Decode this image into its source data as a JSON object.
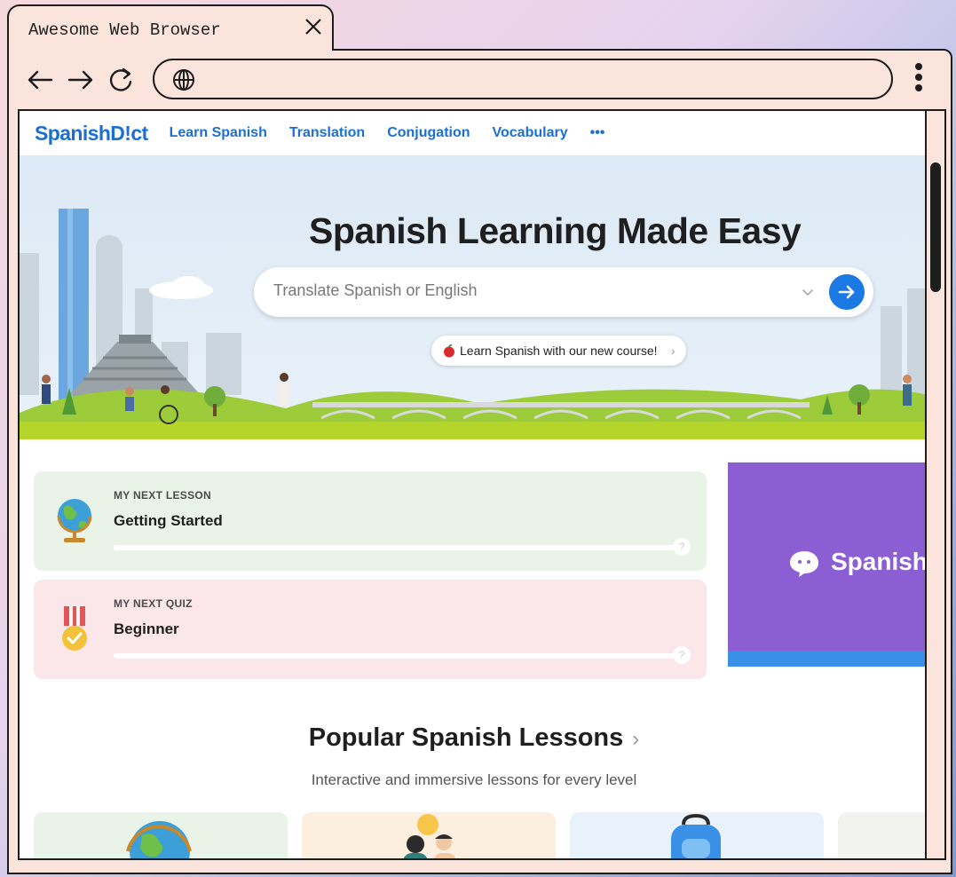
{
  "browser": {
    "tab_title": "Awesome Web Browser",
    "url": ""
  },
  "site": {
    "logo": "SpanishD!ct",
    "nav": [
      "Learn Spanish",
      "Translation",
      "Conjugation",
      "Vocabulary"
    ],
    "nav_more": "•••"
  },
  "hero": {
    "title": "Spanish Learning Made Easy",
    "search_placeholder": "Translate Spanish or English",
    "promo": "Learn Spanish with our new course!"
  },
  "cards": {
    "lesson": {
      "kicker": "MY NEXT LESSON",
      "title": "Getting Started",
      "progress": 0.0
    },
    "quiz": {
      "kicker": "MY NEXT QUIZ",
      "title": "Beginner",
      "progress": 0.0
    }
  },
  "ad": {
    "text": "Spanish"
  },
  "section": {
    "title": "Popular Spanish Lessons",
    "arrow": "›",
    "subtitle": "Interactive and immersive lessons for every level"
  },
  "colors": {
    "brand_blue": "#1b6fd1",
    "ad_purple": "#8b5fd3",
    "lesson_bg": "#eaf3e8",
    "quiz_bg": "#fbe6ea"
  }
}
